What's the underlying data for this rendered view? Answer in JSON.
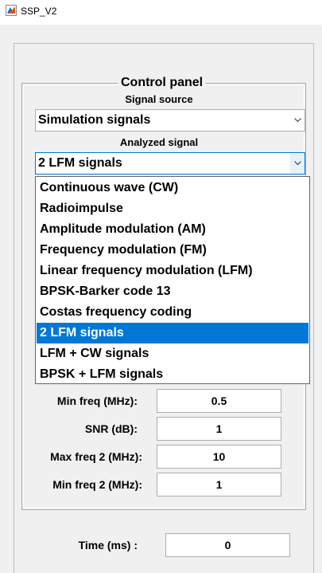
{
  "window": {
    "title": "SSP_V2",
    "icon": "matlab-figure-icon"
  },
  "control_panel": {
    "legend": "Control panel",
    "signal_source_label": "Signal source",
    "signal_source_value": "Simulation signals",
    "analyzed_signal_label": "Analyzed signal",
    "analyzed_signal_value": "2 LFM signals",
    "dropdown_options": [
      "Continuous wave (CW)",
      "Radioimpulse",
      "Amplitude modulation (AM)",
      "Frequency modulation (FM)",
      "Linear frequency modulation (LFM)",
      "BPSK-Barker code 13",
      "Costas frequency coding",
      "2 LFM signals",
      "LFM + CW signals",
      "BPSK + LFM signals"
    ],
    "selected_option": "2 LFM signals"
  },
  "params": [
    {
      "label": "Min freq (MHz):",
      "value": "0.5"
    },
    {
      "label": "SNR (dB):",
      "value": "1"
    },
    {
      "label": "Max freq 2 (MHz):",
      "value": "10"
    },
    {
      "label": "Min freq 2 (MHz):",
      "value": "1"
    }
  ],
  "time": {
    "label": "Time (ms) :",
    "value": "0"
  },
  "colors": {
    "selection": "#0078d7",
    "panel_bg": "#f0f0f0",
    "focus_border": "#0078d7"
  }
}
